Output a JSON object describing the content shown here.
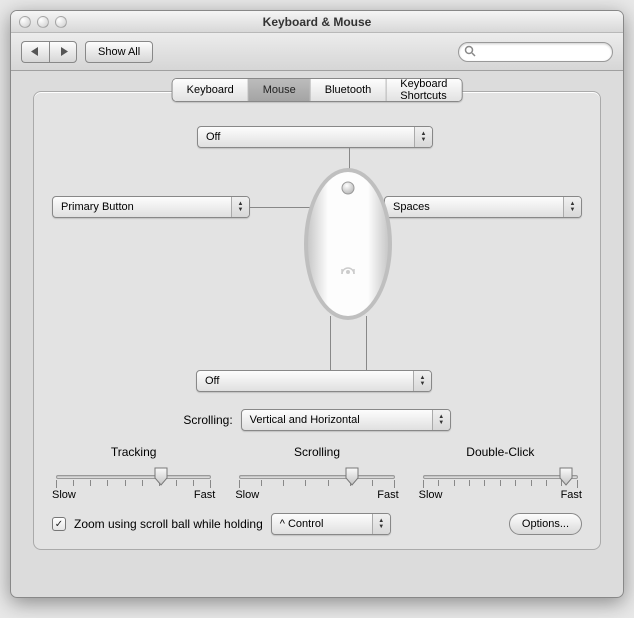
{
  "window": {
    "title": "Keyboard & Mouse"
  },
  "toolbar": {
    "show_all_label": "Show All",
    "search_placeholder": ""
  },
  "tabs": [
    "Keyboard",
    "Mouse",
    "Bluetooth",
    "Keyboard Shortcuts"
  ],
  "active_tab_index": 1,
  "mouse": {
    "scroll_ball_popup": "Off",
    "left_button_popup": "Primary Button",
    "right_button_popup": "Spaces",
    "side_buttons_popup": "Off"
  },
  "scrolling_label": "Scrolling:",
  "scrolling_value": "Vertical and Horizontal",
  "sliders": {
    "tracking": {
      "title": "Tracking",
      "min_label": "Slow",
      "max_label": "Fast",
      "ticks": 10,
      "value": 6
    },
    "scrolling": {
      "title": "Scrolling",
      "min_label": "Slow",
      "max_label": "Fast",
      "ticks": 8,
      "value": 5
    },
    "double_click": {
      "title": "Double-Click",
      "min_label": "Slow",
      "max_label": "Fast",
      "ticks": 11,
      "value": 9
    }
  },
  "zoom": {
    "checked": true,
    "label": "Zoom using scroll ball while holding",
    "modifier": "^ Control",
    "options_label": "Options..."
  }
}
